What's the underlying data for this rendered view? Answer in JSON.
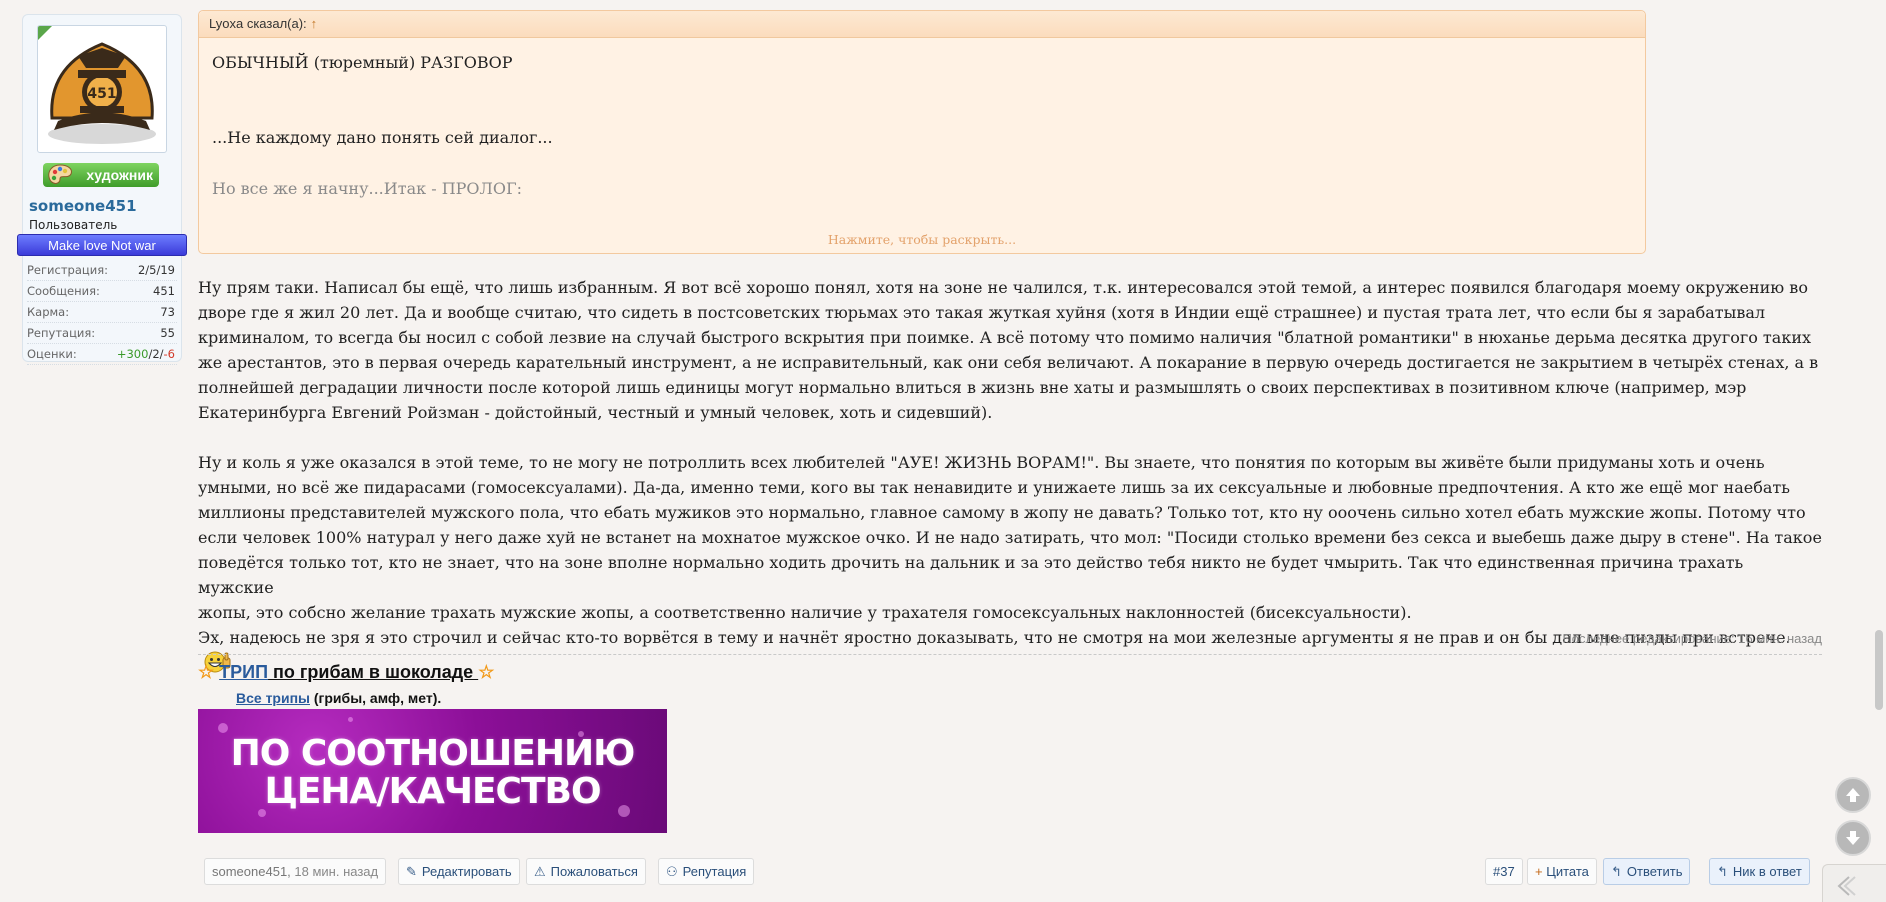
{
  "user": {
    "name": "someone451",
    "title": "Пользователь",
    "banner": "художник",
    "ribbon": "Make love Not war",
    "avatar_icon": "firefighter-helmet-451",
    "stats": [
      {
        "label": "Регистрация:",
        "value": "2/5/19"
      },
      {
        "label": "Сообщения:",
        "value": "451"
      },
      {
        "label": "Карма:",
        "value": "73"
      },
      {
        "label": "Репутация:",
        "value": "55"
      }
    ],
    "ratings_label": "Оценки:",
    "ratings": {
      "pos": "+300",
      "sep1": "/",
      "mid": "2",
      "sep2": "/",
      "neg": "-6"
    }
  },
  "quote": {
    "author": "Lyoxa сказал(а):",
    "arrow": "↑",
    "line1": "ОБЫЧНЫЙ (тюремный) РАЗГОВОР",
    "line2": "...Не каждому дано понять сей диалог...",
    "line3": "Но все же я начну...Итак - ПРОЛОГ:",
    "expand": "Нажмите, чтобы раскрыть..."
  },
  "message": {
    "p1": [
      "Ну прям таки. Написал бы ещё, что лишь избранным. Я вот всё хорошо понял, хотя на зоне не чалился, т.к. интересовался этой темой, а интерес появился благодаря моему окружению во",
      "дворе где я жил 20 лет. Да и вообще считаю, что сидеть в постсоветских тюрьмах это такая жуткая хуйня (хотя в Индии ещё страшнее) и пустая трата лет, что если бы я зарабатывал",
      "криминалом, то всегда бы носил с собой лезвие на случай быстрого вскрытия при поимке. А всё потому что помимо наличия \"блатной романтики\" в нюханье дерьма десятка другого таких",
      "же арестантов, это в первая очередь карательный инструмент, а не исправительный, как они себя величают. А покарание в первую очередь достигается не закрытием в четырёх стенах, а в",
      "полнейшей деградации личности после которой лишь единицы могут нормально влиться в жизнь вне хаты и размышлять о своих перспективах в позитивном ключе (например, мэр",
      "Екатеринбурга Евгений Ройзман - дойстойный, честный и умный человек, хоть и сидевший)."
    ],
    "p2": [
      "Ну и коль я уже оказался в этой теме, то не могу не потроллить всех любителей \"АУЕ! ЖИЗНЬ ВОРАМ!\". Вы знаете, что понятия по которым вы живёте были придуманы хоть и очень",
      "умными, но всё же пидарасами (гомосексуалами). Да-да, именно теми, кого вы так ненавидите и унижаете лишь за их сексуальные и любовные предпочтения. А кто же ещё мог наебать",
      "миллионы представителей мужского пола, что ебать мужиков это нормально, главное самому в жопу не давать? Только тот, кто ну ооочень сильно хотел ебать мужские жопы. Потому что",
      "если человек 100% натурал у него даже хуй не встанет на мохнатое мужское очко. И не надо затирать, что мол: \"Посиди столько времени без секса и выебешь даже дыру в стене\". На такое",
      "поведётся только тот, кто не знает, что на зоне вполне нормально ходить дрочить на дальник и за это действо тебя никто не будет чмырить. Так что единственная причина трахать мужские",
      "жопы, это собсно желание трахать мужские жопы, а соответственно наличие у трахателя гомосексуальных наклонностей (бисексуальности).",
      "Эх, надеюсь не зря я это строчил и сейчас кто-то ворвётся в тему и начнёт яростно доказывать, что не смотря на мои железные аргументы я не прав и он бы дал мне пизды при встрече."
    ],
    "edited": "Последнее редактирование: 16 мин. назад",
    "smiley_icon": "grinning-thumbs-up-smiley-icon"
  },
  "signature": {
    "star": "☆",
    "trip_link": "ТРИП",
    "trip_rest": " по грибам в шоколаде ",
    "all_link": "Все трипы",
    "all_rest": " (грибы, амф, мет).",
    "banner_line1": "ПО СООТНОШЕНИЮ",
    "banner_line2": "ЦЕНА/КАЧЕСТВО"
  },
  "footer": {
    "author": "someone451",
    "time": "18 мин. назад",
    "edit": "Редактировать",
    "report": "Пожаловаться",
    "reputation": "Репутация",
    "post_num": "#37",
    "quote": "Цитата",
    "quote_plus": "+",
    "reply": "Ответить",
    "nick": "Ник в ответ"
  },
  "colors": {
    "quote_bg": "#fff2e4",
    "link": "#2a5b9c",
    "banner_purple": "#8c0f98",
    "artist_green": "#3f9c2a",
    "ribbon_blue": "#3b3bd9"
  }
}
